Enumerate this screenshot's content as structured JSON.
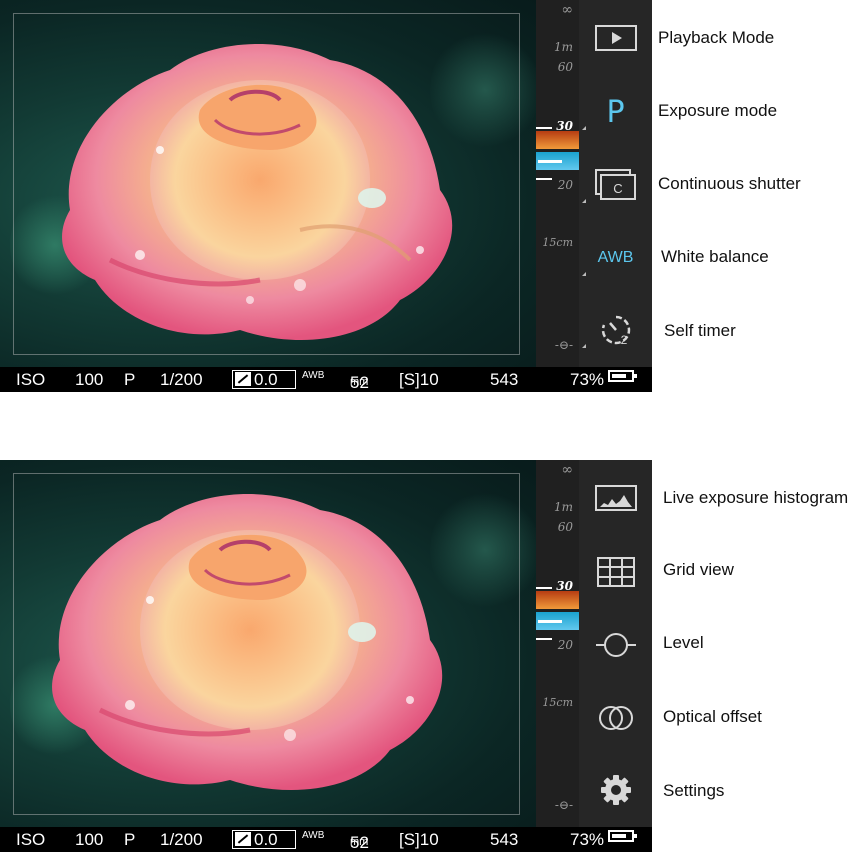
{
  "focus_scale": {
    "infinity": "∞",
    "m1": "1m",
    "m60": "60",
    "m30": "30",
    "m20": "20",
    "cm15": "15cm",
    "min": "-⊖-"
  },
  "status_bar": {
    "iso_label": "ISO",
    "iso_value": "100",
    "mode": "P",
    "shutter": "1/200",
    "ev": "0.0",
    "wb": "AWB",
    "focal": "52",
    "focal_unit": "mm",
    "burst": "[S]10",
    "shots_remaining": "543",
    "battery": "73%"
  },
  "top_toolbar": {
    "exposure_mode_letter": "P",
    "white_balance_text": "AWB",
    "continuous_letter": "C",
    "timer_number": "2"
  },
  "labels_top": {
    "playback": "Playback Mode",
    "exposure": "Exposure mode",
    "continuous": "Continuous shutter",
    "white_balance": "White balance",
    "self_timer": "Self timer"
  },
  "labels_bottom": {
    "histogram": "Live exposure histogram",
    "grid": "Grid view",
    "level": "Level",
    "optical_offset": "Optical offset",
    "settings": "Settings"
  },
  "colors": {
    "accent_blue": "#5cc7ee",
    "toolbar_bg": "#262626",
    "scale_bg": "#202020"
  }
}
